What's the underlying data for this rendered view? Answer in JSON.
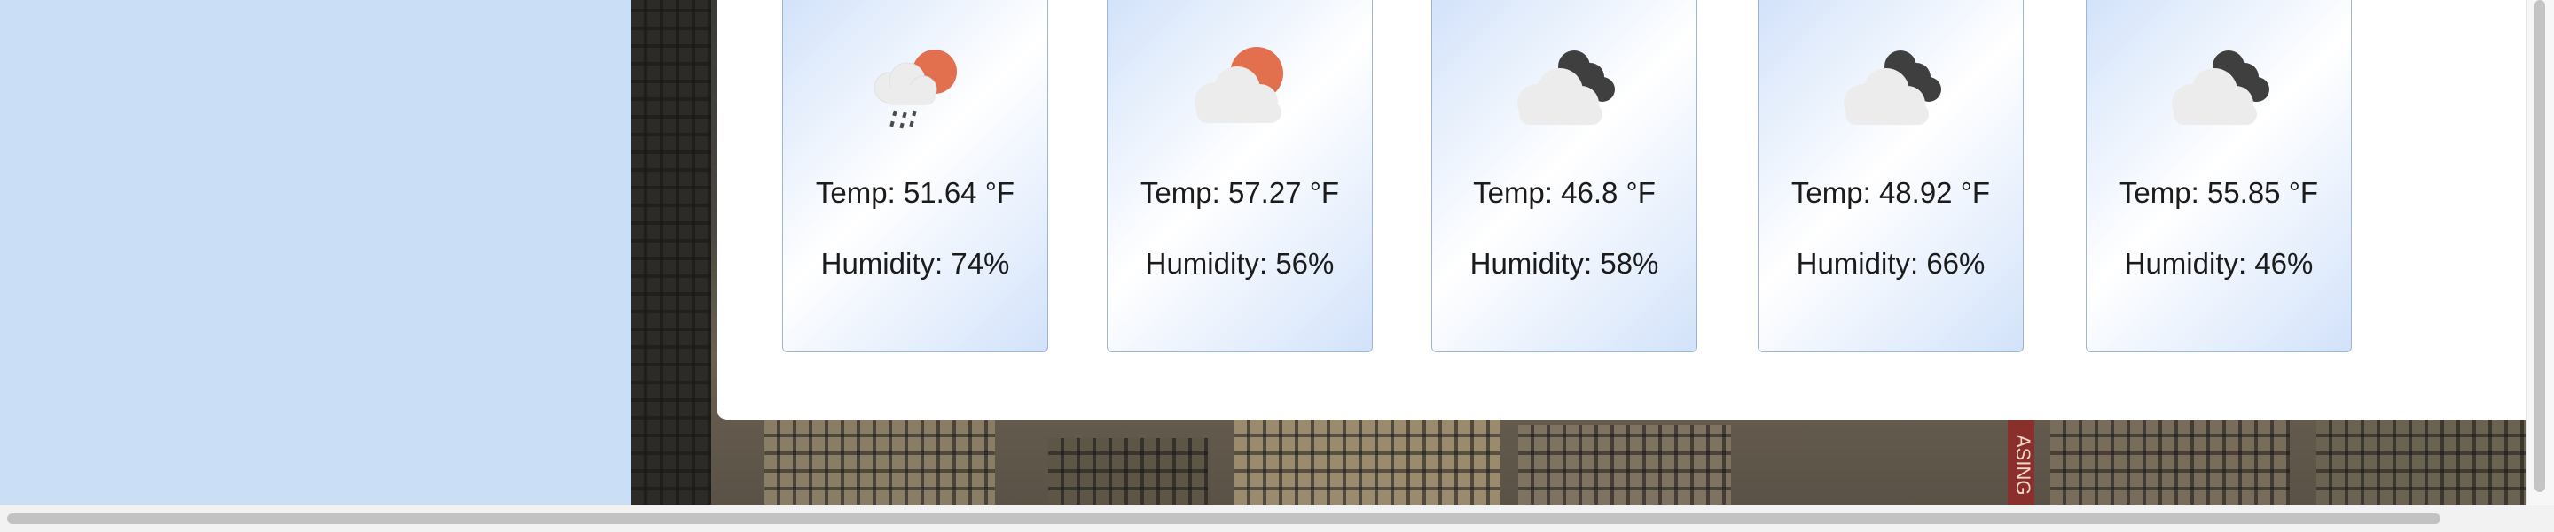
{
  "forecast": {
    "cards": [
      {
        "icon": "light-rain-sun-icon",
        "temp": "Temp: 51.64 °F",
        "humidity": "Humidity: 74%"
      },
      {
        "icon": "partly-cloudy-sun-icon",
        "temp": "Temp: 57.27 °F",
        "humidity": "Humidity: 56%"
      },
      {
        "icon": "broken-clouds-icon",
        "temp": "Temp: 46.8 °F",
        "humidity": "Humidity: 58%"
      },
      {
        "icon": "broken-clouds-icon",
        "temp": "Temp: 48.92 °F",
        "humidity": "Humidity: 66%"
      },
      {
        "icon": "broken-clouds-icon",
        "temp": "Temp: 55.85 °F",
        "humidity": "Humidity: 46%"
      }
    ]
  },
  "background": {
    "sign_text": "ASING"
  },
  "colors": {
    "sidebar": "#cadff6",
    "card_gradient": "#d2e2fa",
    "sun": "#e2704f",
    "dark_cloud": "#3f3f3f",
    "light_cloud": "#ececec"
  }
}
